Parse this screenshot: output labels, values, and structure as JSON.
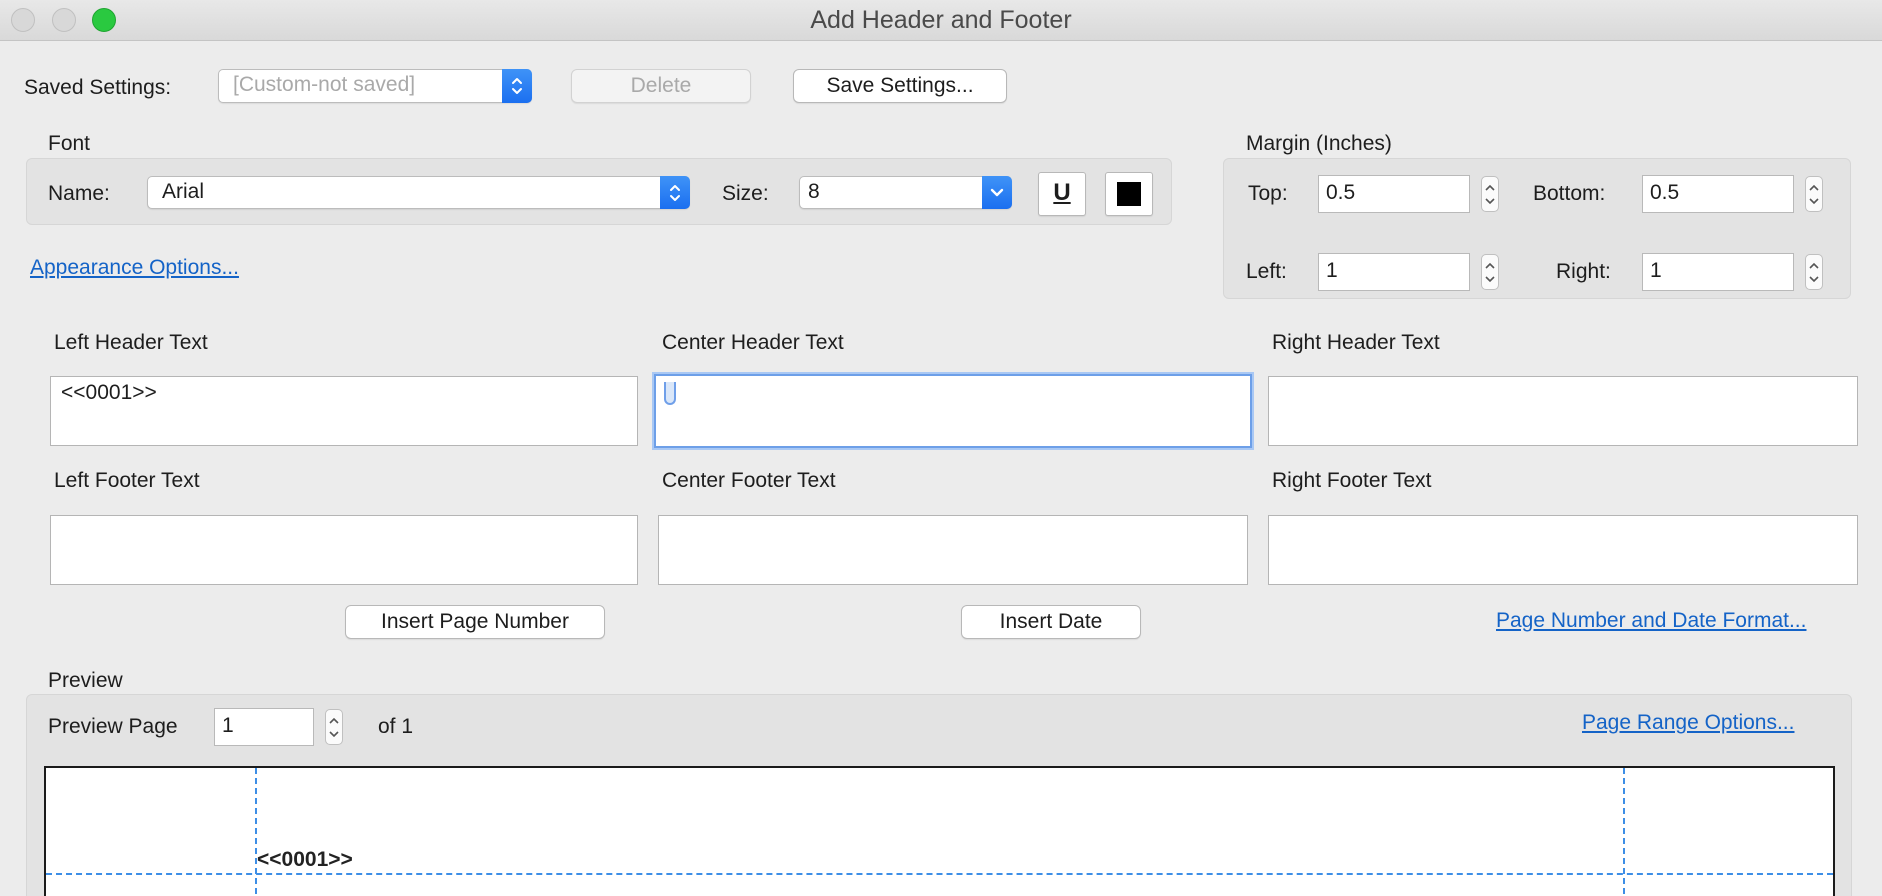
{
  "window": {
    "title": "Add Header and Footer"
  },
  "saved_settings": {
    "label": "Saved Settings:",
    "selected": "[Custom-not saved]",
    "delete_label": "Delete",
    "save_label": "Save Settings..."
  },
  "font": {
    "section_label": "Font",
    "name_label": "Name:",
    "name_value": "Arial",
    "size_label": "Size:",
    "size_value": "8",
    "underline_glyph": "U",
    "color": "#000000"
  },
  "margin": {
    "section_label": "Margin (Inches)",
    "top_label": "Top:",
    "top_value": "0.5",
    "bottom_label": "Bottom:",
    "bottom_value": "0.5",
    "left_label": "Left:",
    "left_value": "1",
    "right_label": "Right:",
    "right_value": "1"
  },
  "appearance_link": "Appearance Options...",
  "header": {
    "left_label": "Left Header Text",
    "left_value": "<<0001>>",
    "center_label": "Center Header Text",
    "center_value": "",
    "right_label": "Right Header Text",
    "right_value": ""
  },
  "footer": {
    "left_label": "Left Footer Text",
    "left_value": "",
    "center_label": "Center Footer Text",
    "center_value": "",
    "right_label": "Right Footer Text",
    "right_value": ""
  },
  "actions": {
    "insert_page_number": "Insert Page Number",
    "insert_date": "Insert Date",
    "page_number_date_format": "Page Number and Date Format..."
  },
  "preview": {
    "section_label": "Preview",
    "page_label": "Preview Page",
    "page_value": "1",
    "of_label": "of 1",
    "range_link": "Page Range Options...",
    "header_text": "<<0001>>"
  },
  "colors": {
    "accent": "#1b6ff0",
    "link": "#1463c7",
    "guide": "#3d8ee6",
    "zoom": "#2ac940"
  }
}
